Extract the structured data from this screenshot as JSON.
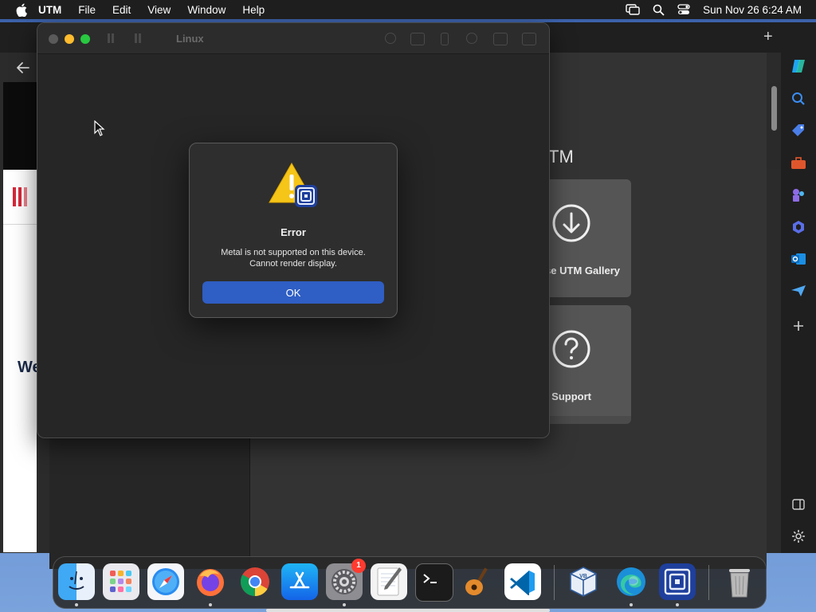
{
  "menubar": {
    "app_name": "UTM",
    "menus": [
      "File",
      "Edit",
      "View",
      "Window",
      "Help"
    ],
    "clock": "Sun Nov 26  6:24 AM"
  },
  "browser": {
    "web_text": "We"
  },
  "utm": {
    "heading": "TM",
    "tiles": [
      {
        "label": "se UTM Gallery",
        "icon": "download-circle-icon"
      },
      {
        "label": "Support",
        "icon": "question-circle-icon"
      }
    ]
  },
  "vm_window": {
    "title": "Linux"
  },
  "dialog": {
    "title": "Error",
    "message_line1": "Metal is not supported on this device.",
    "message_line2": "Cannot render display.",
    "ok_label": "OK"
  },
  "dock": {
    "items": [
      {
        "name": "finder",
        "icon": "finder-icon"
      },
      {
        "name": "launchpad",
        "icon": "launchpad-icon"
      },
      {
        "name": "safari",
        "icon": "safari-icon"
      },
      {
        "name": "firefox",
        "icon": "firefox-icon"
      },
      {
        "name": "chrome",
        "icon": "chrome-icon"
      },
      {
        "name": "app-store",
        "icon": "app-store-icon"
      },
      {
        "name": "system-settings",
        "icon": "settings-gear-icon",
        "badge": "1"
      },
      {
        "name": "textedit",
        "icon": "notepad-icon"
      },
      {
        "name": "terminal",
        "icon": "terminal-icon"
      },
      {
        "name": "garageband",
        "icon": "guitar-icon"
      },
      {
        "name": "vscode",
        "icon": "vscode-icon"
      },
      {
        "name": "virtualbox",
        "icon": "virtualbox-icon"
      },
      {
        "name": "edge",
        "icon": "edge-icon"
      },
      {
        "name": "utm",
        "icon": "utm-icon"
      },
      {
        "name": "trash",
        "icon": "trash-icon"
      }
    ]
  },
  "colors": {
    "accent_blue": "#2f5ec4",
    "desktop_top": "#3a5fa8",
    "warning_yellow": "#f5c518"
  }
}
